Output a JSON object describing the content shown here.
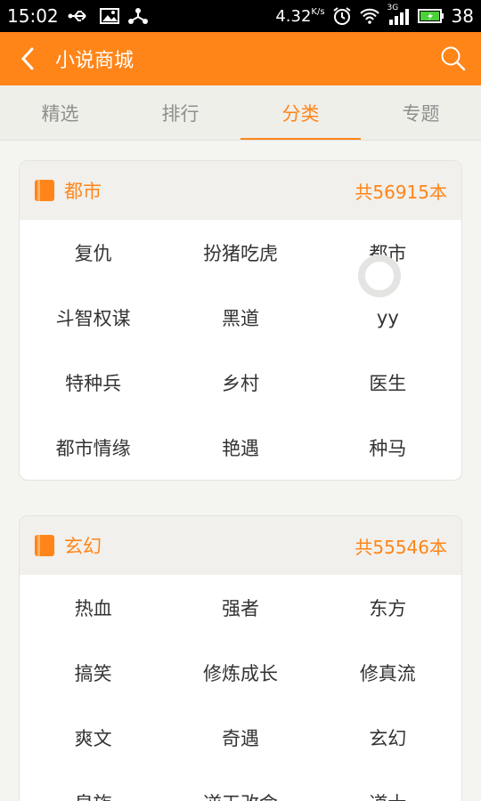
{
  "status_bar": {
    "time": "15:02",
    "network_speed": "4.32",
    "speed_unit": "K/s",
    "battery": "38",
    "network_type": "3G"
  },
  "app_bar": {
    "title": "小说商城"
  },
  "tabs": [
    {
      "label": "精选",
      "active": false
    },
    {
      "label": "排行",
      "active": false
    },
    {
      "label": "分类",
      "active": true
    },
    {
      "label": "专题",
      "active": false
    }
  ],
  "categories": [
    {
      "title": "都市",
      "count": "共56915本",
      "items": [
        "复仇",
        "扮猪吃虎",
        "都市",
        "斗智权谋",
        "黑道",
        "yy",
        "特种兵",
        "乡村",
        "医生",
        "都市情缘",
        "艳遇",
        "种马"
      ]
    },
    {
      "title": "玄幻",
      "count": "共55546本",
      "items": [
        "热血",
        "强者",
        "东方",
        "搞笑",
        "修炼成长",
        "修真流",
        "爽文",
        "奇遇",
        "玄幻",
        "皇族",
        "逆天改命",
        "道士"
      ]
    }
  ],
  "colors": {
    "accent": "#ff8519",
    "status_bar": "#000000"
  }
}
